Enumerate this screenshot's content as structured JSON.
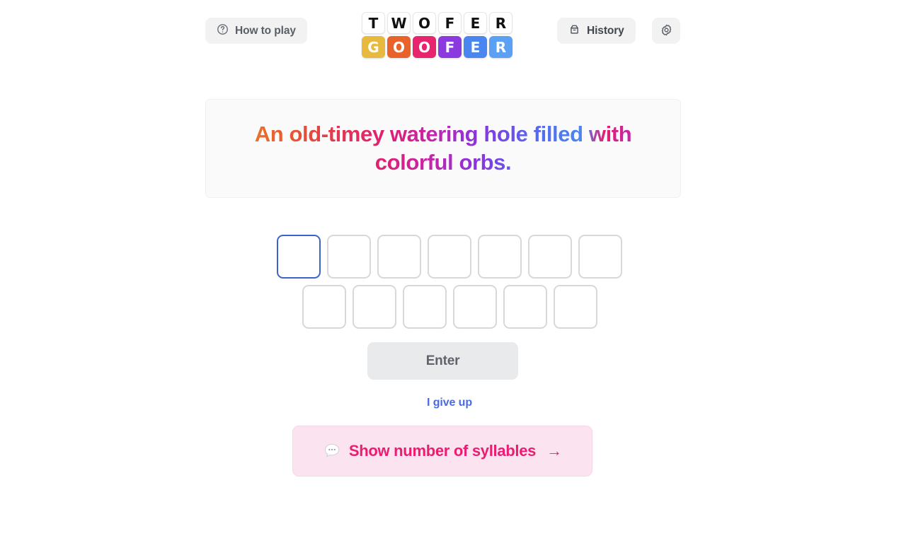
{
  "header": {
    "how_to_play_label": "How to play",
    "history_label": "History",
    "how_to_play_icon": "question-circle-icon",
    "history_icon": "archive-box-icon",
    "settings_icon": "gear-icon"
  },
  "logo": {
    "top_word": "TWOFER",
    "bottom_word": "GOOFER",
    "top_letters": [
      "T",
      "W",
      "O",
      "F",
      "E",
      "R"
    ],
    "bottom_letters": [
      "G",
      "O",
      "O",
      "F",
      "E",
      "R"
    ],
    "bottom_colors": [
      "#e8b93f",
      "#e8622a",
      "#e8246e",
      "#8b3ae0",
      "#4a86f0",
      "#5aa0f5"
    ]
  },
  "clue": {
    "text": "An old-timey watering hole filled with colorful orbs."
  },
  "guess": {
    "row1_length": 7,
    "row2_length": 6,
    "row1_values": [
      "",
      "",
      "",
      "",
      "",
      "",
      ""
    ],
    "row2_values": [
      "",
      "",
      "",
      "",
      "",
      ""
    ],
    "focused_index": 0,
    "focus_color": "#3d63c9"
  },
  "actions": {
    "enter_label": "Enter",
    "give_up_label": "I give up",
    "syllables_label": "Show number of syllables",
    "syllables_arrow": "→",
    "syllables_icon": "speech-bubble-icon",
    "accent_pink": "#ec1c72",
    "link_blue": "#4a6ce0"
  }
}
